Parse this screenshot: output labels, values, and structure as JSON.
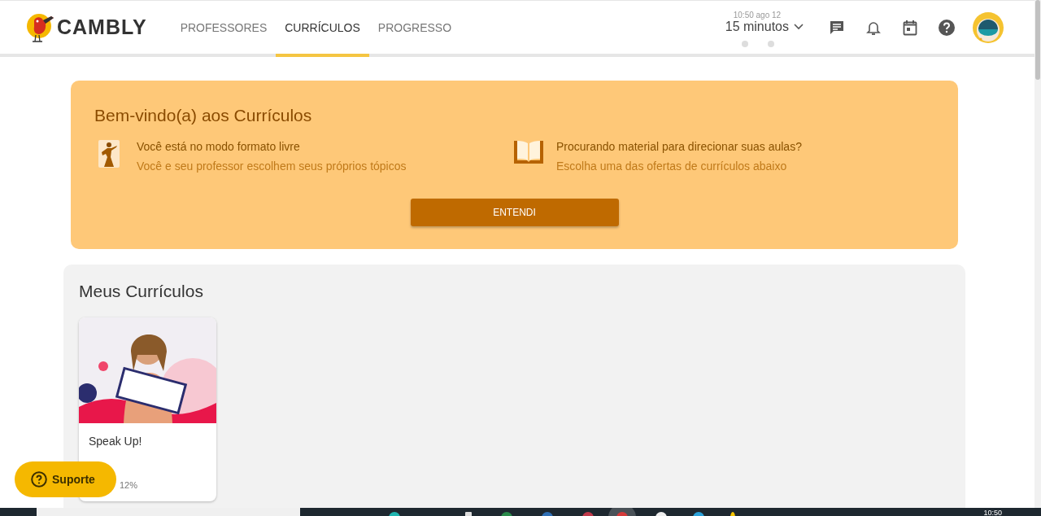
{
  "header": {
    "logo": "CAMBLY",
    "nav": [
      {
        "label": "PROFESSORES",
        "selected": false
      },
      {
        "label": "CURRÍCULOS",
        "selected": true
      },
      {
        "label": "PROGRESSO",
        "selected": false
      }
    ],
    "clock": "10:50 ago 12",
    "minutes": "15 minutos"
  },
  "banner": {
    "title": "Bem-vindo(a) aos Currículos",
    "items": [
      {
        "kind": "person",
        "title": "Você está no modo formato livre",
        "subtitle": "Você e seu professor escolhem seus próprios tópicos"
      },
      {
        "kind": "book",
        "title": "Procurando material para direcionar suas aulas?",
        "subtitle": "Escolha uma das ofertas de currículos abaixo"
      }
    ],
    "button": "ENTENDI"
  },
  "curricula": {
    "title": "Meus Currículos",
    "cards": [
      {
        "title": "Speak Up!",
        "progress": "12%"
      }
    ]
  },
  "support_button": "Suporte",
  "taskbar": {
    "clock": "10:50"
  }
}
